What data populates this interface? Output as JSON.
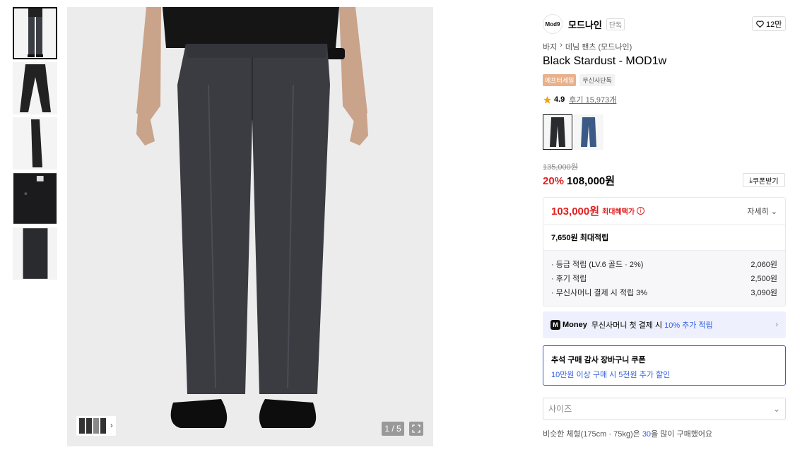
{
  "gallery": {
    "thumbnails": [
      "thumb-model-front",
      "thumb-flat-front",
      "thumb-side",
      "thumb-detail-waist",
      "thumb-fabric"
    ],
    "counter": "1 / 5"
  },
  "brand": {
    "logo_text": "Mod9",
    "name": "모드나인",
    "tag": "단독",
    "likes": "12만"
  },
  "breadcrumb": [
    "바지",
    "데님 팬츠 (모드나인)"
  ],
  "product": {
    "title": "Black Stardust - MOD1w",
    "badges": [
      "에프터세일",
      "무신사단독"
    ],
    "rating": "4.9",
    "reviews": "후기 15,973개",
    "original_price": "135,000원",
    "discount": "20%",
    "price": "108,000원",
    "coupon_button": "쿠폰받기"
  },
  "benefit": {
    "max_price": "103,000원",
    "max_label": "최대혜택가",
    "detail_label": "자세히",
    "points_total": "7,650원 최대적립",
    "points": [
      {
        "label": "· 등급 적립 (LV.6 골드 · 2%)",
        "value": "2,060원"
      },
      {
        "label": "· 후기 적립",
        "value": "2,500원"
      },
      {
        "label": "· 무신사머니 결제 시 적립 3%",
        "value": "3,090원"
      }
    ]
  },
  "money": {
    "logo": "M",
    "brand": "Money",
    "text_pre": "무신사머니 첫 결제 시",
    "highlight": "10% 추가 적립"
  },
  "coupon": {
    "title": "추석 구매 감사 장바구니 쿠폰",
    "desc": "10만원 이상 구매 시 5천원 추가 할인"
  },
  "size": {
    "placeholder": "사이즈"
  },
  "similar": {
    "pre": "비슷한 체형(175cm · 75kg)은",
    "highlight": "30",
    "post": "을 많이 구매했어요"
  },
  "colors": {
    "accent": "#2f5de0",
    "sale": "#e02020"
  }
}
